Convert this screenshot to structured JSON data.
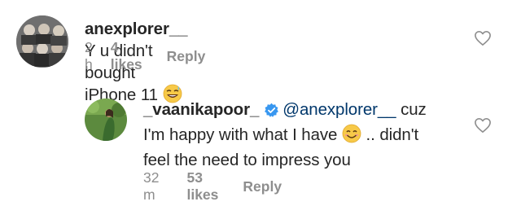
{
  "comments": [
    {
      "username": "anexplorer__",
      "text": "Y u didn't bought iPhone 11",
      "emoji": "sweat-smile-emoji",
      "time": "2 h",
      "likes": "4 likes",
      "reply_label": "Reply"
    },
    {
      "username": "_vaanikapoor_",
      "verified": true,
      "mention": "@anexplorer__",
      "text_line1_end": "cuz",
      "text_line2_start": "I'm happy with what I have",
      "emoji": "smiling-emoji",
      "text_line2_end": ".. didn't",
      "text_line3": "feel the need to impress you",
      "time": "32 m",
      "likes": "53 likes",
      "reply_label": "Reply"
    }
  ],
  "colors": {
    "text": "#262626",
    "meta": "#8e8e8e",
    "mention": "#00376b",
    "verified": "#3897f0"
  }
}
